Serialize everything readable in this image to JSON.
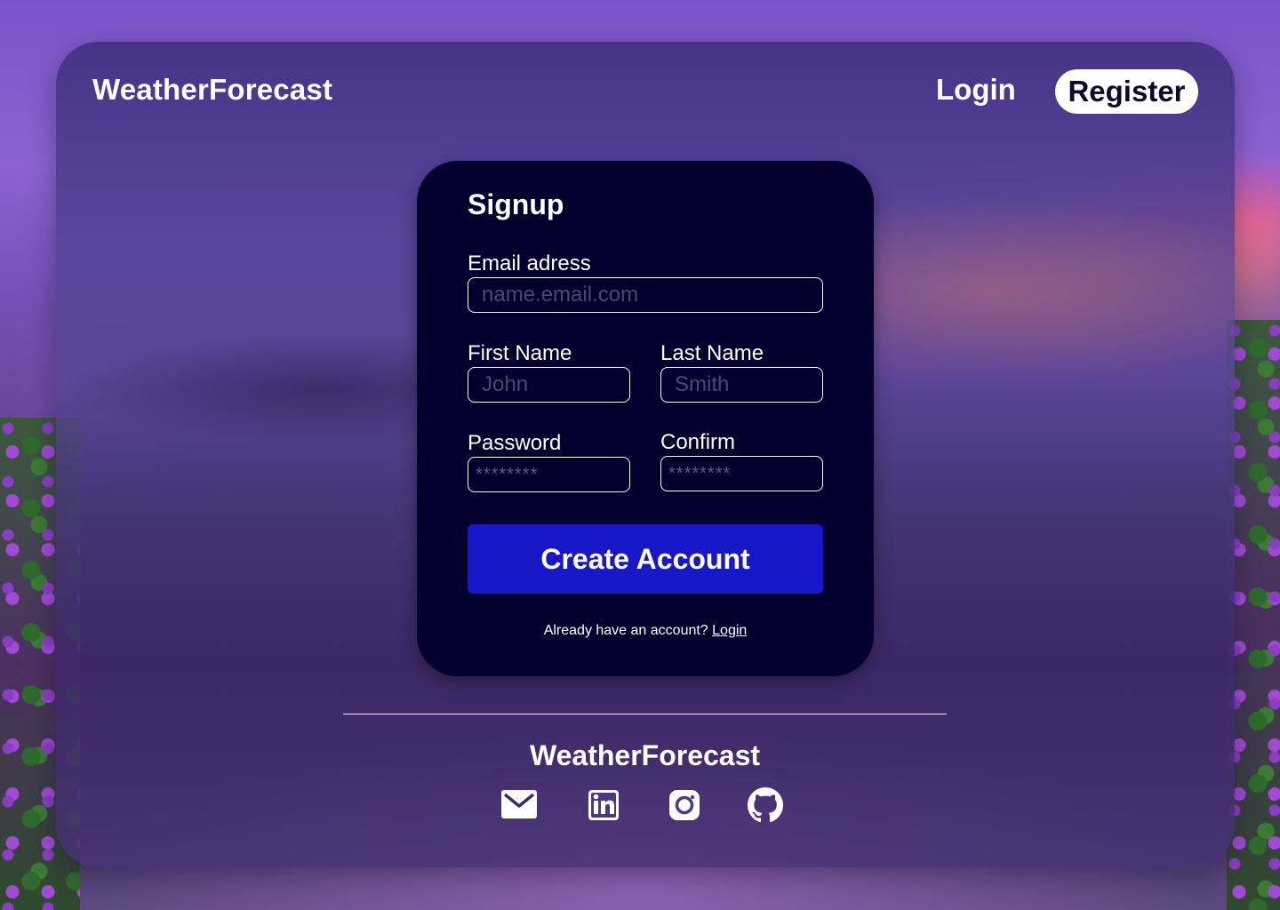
{
  "header": {
    "brand": "WeatherForecast",
    "login_label": "Login",
    "register_label": "Register"
  },
  "signup": {
    "title": "Signup",
    "email": {
      "label": "Email adress",
      "placeholder": "name.email.com"
    },
    "first_name": {
      "label": "First Name",
      "placeholder": "John"
    },
    "last_name": {
      "label": "Last Name",
      "placeholder": "Smith"
    },
    "password": {
      "label": "Password",
      "placeholder": "********"
    },
    "confirm": {
      "label": "Confirm",
      "placeholder": "********"
    },
    "submit_label": "Create Account",
    "already_text": "Already have an account?",
    "login_link": "Login"
  },
  "footer": {
    "brand": "WeatherForecast",
    "icons": [
      "mail-icon",
      "linkedin-icon",
      "instagram-icon",
      "github-icon"
    ]
  },
  "colors": {
    "card_bg": "#03002e",
    "button_bg": "#1818c8",
    "text": "#ffffff"
  }
}
